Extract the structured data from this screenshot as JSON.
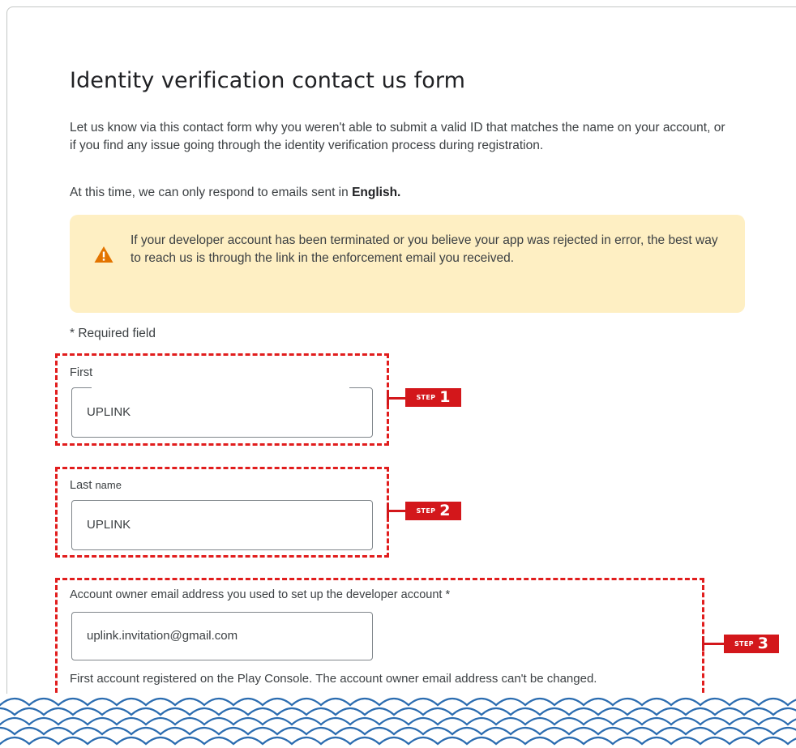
{
  "page": {
    "title": "Identity verification contact us form",
    "intro": "Let us know via this contact form why you weren't able to submit a valid ID that matches the name on your account, or if you find any issue going through the identity verification process during registration.",
    "lang_note_prefix": "At this time, we can only respond to emails sent in ",
    "lang_note_bold": "English."
  },
  "warning": {
    "icon": "warning-triangle-icon",
    "text": "If your developer account has been terminated or you believe your app was rejected in error, the best way to reach us is through the link in the enforcement email you received."
  },
  "required_note": "* Required field",
  "fields": {
    "first_name": {
      "label": "First",
      "value": "UPLINK"
    },
    "last_name": {
      "label_main": "Last",
      "label_small": "name",
      "value": "UPLINK"
    },
    "email": {
      "label": "Account owner email address you used to set up the developer account *",
      "value": "uplink.invitation@gmail.com",
      "helper": "First account registered on the Play Console. The account owner email address can't be changed."
    }
  },
  "steps": [
    {
      "word": "STEP",
      "number": "1"
    },
    {
      "word": "STEP",
      "number": "2"
    },
    {
      "word": "STEP",
      "number": "3"
    }
  ],
  "colors": {
    "annotation_red": "#e11d1d",
    "warning_bg": "#feefc3",
    "warning_icon": "#e37400",
    "wave_stroke": "#2b6cb0"
  }
}
